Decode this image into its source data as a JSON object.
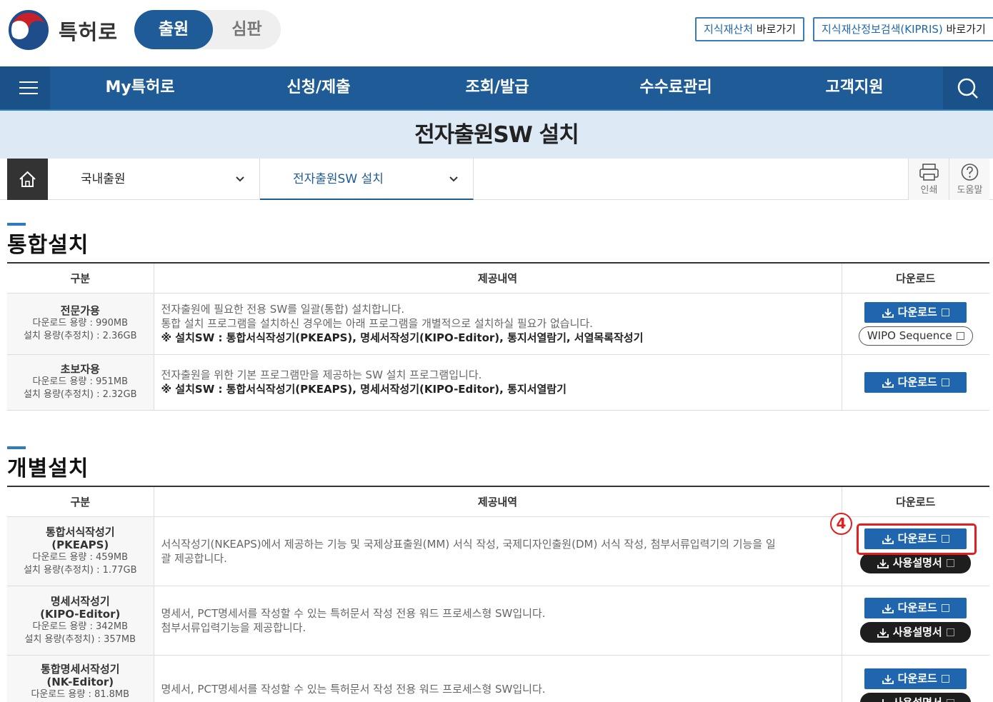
{
  "header": {
    "brand": "특허로",
    "tabs": [
      "출원",
      "심판"
    ],
    "links": [
      {
        "label": "지식재산처",
        "suffix": " 바로가기"
      },
      {
        "label": "지식재산정보검색(KIPRIS)",
        "suffix": " 바로가기"
      }
    ]
  },
  "nav": {
    "items": [
      "My특허로",
      "신청/제출",
      "조회/발급",
      "수수료관리",
      "고객지원"
    ]
  },
  "page_title": "전자출원SW 설치",
  "breadcrumb": {
    "level1": "국내출원",
    "level2": "전자출원SW 설치",
    "tools": [
      "인쇄",
      "도움말"
    ]
  },
  "sections": [
    {
      "title": "통합설치",
      "headers": [
        "구분",
        "제공내역",
        "다운로드"
      ],
      "rows": [
        {
          "name": "전문가용",
          "size": [
            "다운로드 용량 : 990MB",
            "설치 용량(추정치) : 2.36GB"
          ],
          "desc": [
            "전자출원에 필요한 전용 SW를 일괄(통합) 설치합니다.",
            "통합 설치 프로그램을 설치하신 경우에는 아래 프로그램을 개별적으로 설치하실 필요가 없습니다."
          ],
          "note": "※ 설치SW : 통합서식작성기(PKEAPS), 명세서작성기(KIPO-Editor), 통지서열람기, 서열목록작성기",
          "buttons": [
            "다운로드",
            "WIPO Sequence"
          ]
        },
        {
          "name": "초보자용",
          "size": [
            "다운로드 용량 : 951MB",
            "설치 용량(추정치) : 2.32GB"
          ],
          "desc": [
            "전자출원을 위한 기본 프로그램만을 제공하는 SW 설치 프로그램입니다."
          ],
          "note": "※ 설치SW : 통합서식작성기(PKEAPS), 명세서작성기(KIPO-Editor), 통지서열람기",
          "buttons": [
            "다운로드"
          ]
        }
      ]
    },
    {
      "title": "개별설치",
      "headers": [
        "구분",
        "제공내역",
        "다운로드"
      ],
      "rows": [
        {
          "name": "통합서식작성기",
          "sub": "(PKEAPS)",
          "size": [
            "다운로드 용량 : 459MB",
            "설치 용량(추정치) : 1.77GB"
          ],
          "desc": [
            "서식작성기(NKEAPS)에서 제공하는 기능 및 국제상표출원(MM) 서식 작성, 국제디자인출원(DM) 서식 작성, 첨부서류입력기의 기능을 일",
            "괄 제공합니다."
          ],
          "buttons": [
            "다운로드",
            "사용설명서"
          ]
        },
        {
          "name": "명세서작성기",
          "sub": "(KIPO-Editor)",
          "size": [
            "다운로드 용량 : 342MB",
            "설치 용량(추정치) : 357MB"
          ],
          "desc": [
            "명세서, PCT명세서를 작성할 수 있는 특허문서 작성 전용 워드 프로세스형 SW입니다.",
            "첨부서류입력기능을 제공합니다."
          ],
          "buttons": [
            "다운로드",
            "사용설명서"
          ]
        },
        {
          "name": "통합명세서작성기",
          "sub": "(NK-Editor)",
          "size": [
            "다운로드 용량 : 81.8MB"
          ],
          "desc": [
            "명세서, PCT명세서를 작성할 수 있는 특허문서 작성 전용 워드 프로세스형 SW입니다."
          ],
          "buttons": [
            "다운로드",
            "사용설명서"
          ]
        }
      ]
    }
  ],
  "annotation": {
    "step": "4"
  },
  "colors": {
    "primary": "#1f5c97",
    "button_blue": "#1f66ae",
    "highlight": "#e02020",
    "band": "#dde9f5"
  }
}
